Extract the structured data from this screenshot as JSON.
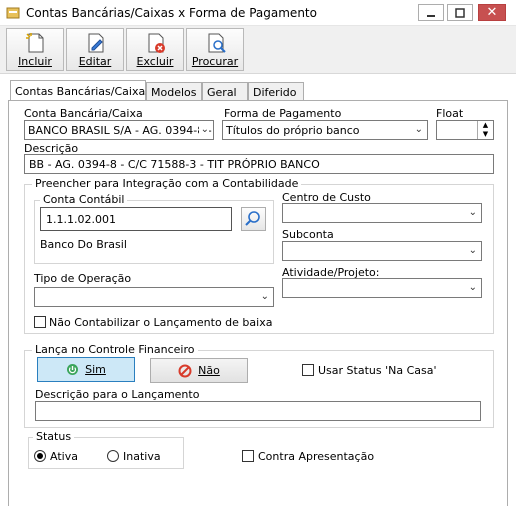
{
  "window": {
    "title": "Contas Bancárias/Caixas x Forma de Pagamento"
  },
  "toolbar": {
    "incluir": "Incluir",
    "editar": "Editar",
    "excluir": "Excluir",
    "procurar": "Procurar"
  },
  "tabs": [
    "Contas Bancárias/Caixas",
    "Modelos",
    "Geral",
    "Diferido"
  ],
  "form": {
    "conta_label": "Conta Bancária/Caixa",
    "conta_value": "BANCO BRASIL S/A - AG. 0394-8 -",
    "forma_label": "Forma de Pagamento",
    "forma_value": "Títulos do próprio banco",
    "float_label": "Float",
    "float_value": "",
    "descricao_label": "Descrição",
    "descricao_value": "BB - AG. 0394-8 - C/C 71588-3 - TIT PRÓPRIO BANCO"
  },
  "integracao": {
    "title": "Preencher para Integração com a Contabilidade",
    "conta_contabil_title": "Conta Contábil",
    "conta_contabil_value": "1.1.1.02.001",
    "conta_contabil_desc": "Banco Do Brasil",
    "centro_label": "Centro de Custo",
    "subconta_label": "Subconta",
    "tipo_label": "Tipo de Operação",
    "atividade_label": "Atividade/Projeto:",
    "nao_contabilizar": "Não Contabilizar o Lançamento de baixa"
  },
  "financeiro": {
    "title": "Lança no Controle Financeiro",
    "sim": "Sim",
    "nao": "Não",
    "usar_status": "Usar Status 'Na Casa'",
    "descricao_lancamento": "Descrição para o Lançamento"
  },
  "status": {
    "title": "Status",
    "ativa": "Ativa",
    "inativa": "Inativa",
    "contra_apresentacao": "Contra Apresentação"
  }
}
